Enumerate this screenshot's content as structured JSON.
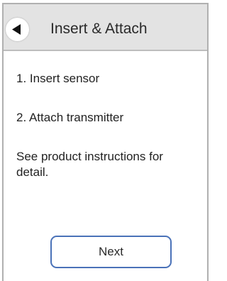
{
  "header": {
    "title": "Insert & Attach",
    "back_icon": "back-arrow-icon"
  },
  "content": {
    "steps": [
      "1. Insert sensor",
      "2. Attach transmitter"
    ],
    "note": "See product instructions for detail."
  },
  "footer": {
    "next_label": "Next"
  },
  "colors": {
    "header_background": "#e3e3e3",
    "button_border": "#4a72b8",
    "text": "#222222"
  }
}
